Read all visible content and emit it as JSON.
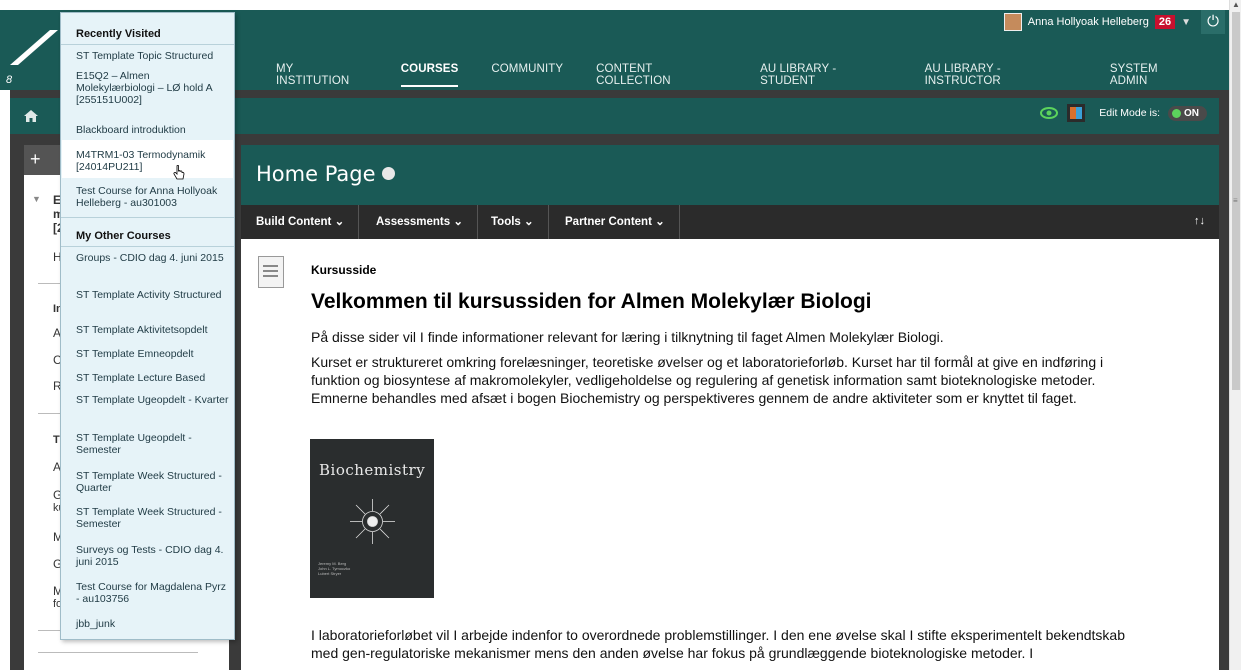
{
  "header": {
    "user_name": "Anna Hollyoak Helleberg",
    "notification_count": "26",
    "nav_items": [
      {
        "label": "MY INSTITUTION",
        "active": false
      },
      {
        "label": "COURSES",
        "active": true
      },
      {
        "label": "COMMUNITY",
        "active": false
      },
      {
        "label": "CONTENT COLLECTION",
        "active": false
      },
      {
        "label": "AU LIBRARY - STUDENT",
        "active": false
      },
      {
        "label": "AU LIBRARY - INSTRUCTOR",
        "active": false
      },
      {
        "label": "SYSTEM ADMIN",
        "active": false
      }
    ]
  },
  "breadcrumb_bar": {
    "edit_mode_label": "Edit Mode is:",
    "edit_mode_value": "ON"
  },
  "course_menu": {
    "items": [
      "E",
      "m",
      "[2",
      "H",
      "In",
      "A",
      "C",
      "R",
      "T",
      "A",
      "G",
      "ku",
      "M",
      "G",
      "M",
      "fo"
    ]
  },
  "page": {
    "title": "Home Page",
    "action_bar": [
      "Build Content",
      "Assessments",
      "Tools",
      "Partner Content"
    ],
    "sort_label": "↑↓"
  },
  "content": {
    "item_title": "Kursusside",
    "heading": "Velkommen til kursussiden for Almen Molekylær Biologi",
    "paragraph_1": "På disse sider vil I finde informationer relevant for læring i tilknytning til faget Almen Molekylær Biologi.",
    "paragraph_2_lines": [
      "Kurset er struktureret omkring forelæsninger, teoretiske øvelser og et laboratorieforløb. Kurset har til formål at give en indføring i",
      "funktion og biosyntese af makromolekyler, vedligeholdelse og regulering af genetisk information samt bioteknologiske metoder.",
      "Emnerne behandles med afsæt i bogen Biochemistry og perspektiveres gennem de andre aktiviteter som er knyttet til faget."
    ],
    "book_title": "Biochemistry",
    "book_authors": [
      "Jeremy M. Berg",
      "John L. Tymoczko",
      "Lubert Stryer"
    ],
    "paragraph_3_lines": [
      "I laboratorieforløbet vil I arbejde indenfor to overordnede problemstillinger. I den ene øvelse skal I stifte eksperimentelt bekendtskab",
      "med gen-regulatoriske mekanismer mens den anden øvelse har fokus på grundlæggende bioteknologiske metoder. I"
    ]
  },
  "dropdown": {
    "recent_header": "Recently Visited",
    "recent_items": [
      "ST Template Topic Structured",
      "E15Q2 – Almen Molekylærbiologi – LØ hold A [255151U002]",
      "Blackboard introduktion",
      "M4TRM1-03 Termodynamik [24014PU211]",
      "Test Course for Anna Hollyoak Helleberg - au301003"
    ],
    "other_header": "My Other Courses",
    "other_items": [
      "Groups - CDIO dag 4. juni 2015",
      "ST Template Activity Structured",
      "ST Template Aktivitetsopdelt",
      "ST Template Emneopdelt",
      "ST Template Lecture Based",
      "ST Template Ugeopdelt - Kvarter",
      "ST Template Ugeopdelt - Semester",
      "ST Template Week Structured - Quarter",
      "ST Template Week Structured - Semester",
      "Surveys og Tests - CDIO dag 4. juni 2015",
      "Test Course for Magdalena Pyrz - au103756",
      "jbb_junk"
    ]
  }
}
